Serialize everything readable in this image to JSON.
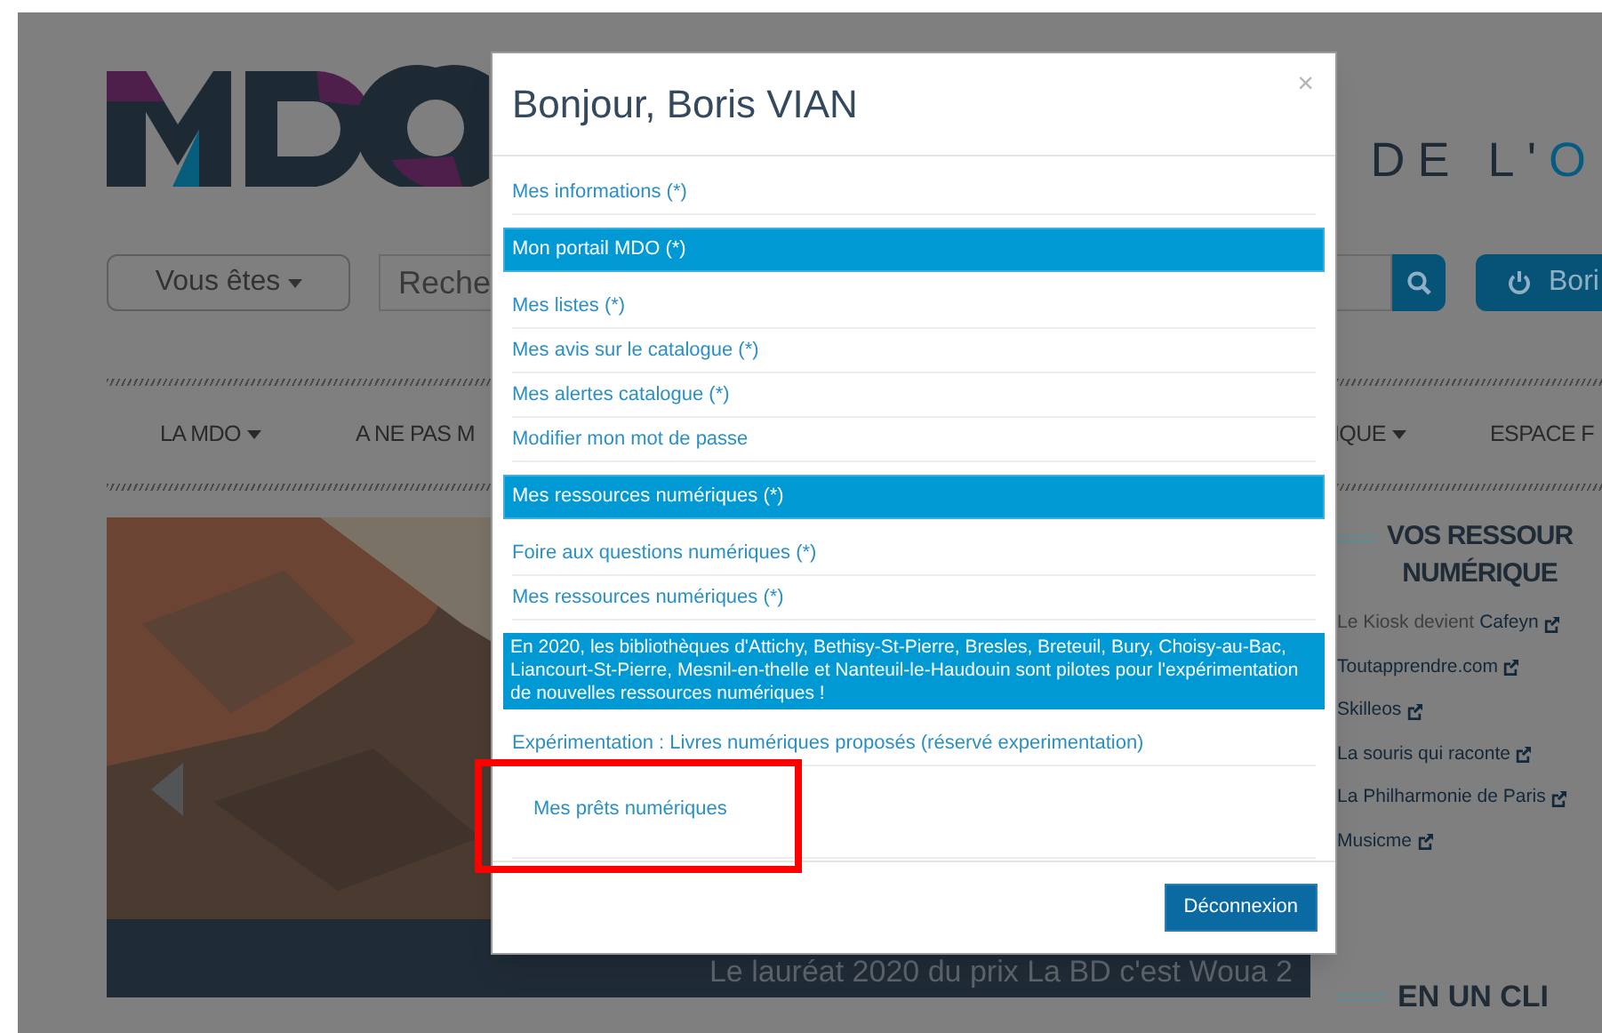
{
  "page": {
    "tagline": "DE L'",
    "tagline_accent": "O",
    "audience_button": {
      "label": "Vous êtes",
      "dropdown": true
    },
    "search": {
      "placeholder": "Reche"
    },
    "account_button": "Bori",
    "nav": [
      {
        "label": "LA MDO",
        "dropdown": true
      },
      {
        "label": "A NE PAS M",
        "dropdown": false
      },
      {
        "label": "IQUE",
        "dropdown": true
      },
      {
        "label": "ESPACE F",
        "dropdown": false
      }
    ],
    "carousel": {
      "kind": "picture",
      "caption": "Le lauréat 2020 du prix La BD c'est Woua 2"
    },
    "sidebar": {
      "heading_lines": [
        "VOS RESSOUR",
        "NUMÉRIQUE"
      ],
      "links": [
        {
          "prefix": "Le Kiosk devient",
          "label": "Cafeyn"
        },
        {
          "label": "Toutapprendre.com"
        },
        {
          "label": "Skilleos"
        },
        {
          "label": "La souris qui raconte"
        },
        {
          "label": "La Philharmonie de Paris"
        },
        {
          "label": "Musicme"
        }
      ],
      "heading2": "EN UN CLI"
    }
  },
  "modal": {
    "title": "Bonjour, Boris VIAN",
    "close": "×",
    "items": [
      {
        "kind": "link",
        "label": "Mes informations (*)",
        "highlighted": false
      },
      {
        "kind": "section",
        "label": "Mon portail MDO (*)"
      },
      {
        "kind": "link",
        "label": "Mes listes (*)",
        "highlighted": false
      },
      {
        "kind": "link",
        "label": "Mes avis sur le catalogue (*)",
        "highlighted": false
      },
      {
        "kind": "link",
        "label": "Mes alertes catalogue (*)",
        "highlighted": false
      },
      {
        "kind": "link",
        "label": "Modifier mon mot de passe",
        "highlighted": false
      },
      {
        "kind": "section",
        "label": "Mes ressources numériques (*)"
      },
      {
        "kind": "link",
        "label": "Foire aux questions numériques (*)",
        "highlighted": false
      },
      {
        "kind": "link",
        "label": "Mes ressources numériques (*)",
        "highlighted": false
      },
      {
        "kind": "notice",
        "label": "En 2020, les bibliothèques d'Attichy, Bethisy-St-Pierre, Bresles, Breteuil, Bury, Choisy-au-Bac, Liancourt-St-Pierre, Mesnil-en-thelle et Nanteuil-le-Haudouin sont pilotes pour l'expérimentation de nouvelles ressources numériques !"
      },
      {
        "kind": "link",
        "label": "Expérimentation : Livres numériques proposés (réservé experimentation)",
        "highlighted": false
      },
      {
        "kind": "padded_link",
        "label": "Mes prêts numériques",
        "highlighted": true
      }
    ],
    "logout_button": "Déconnexion"
  }
}
